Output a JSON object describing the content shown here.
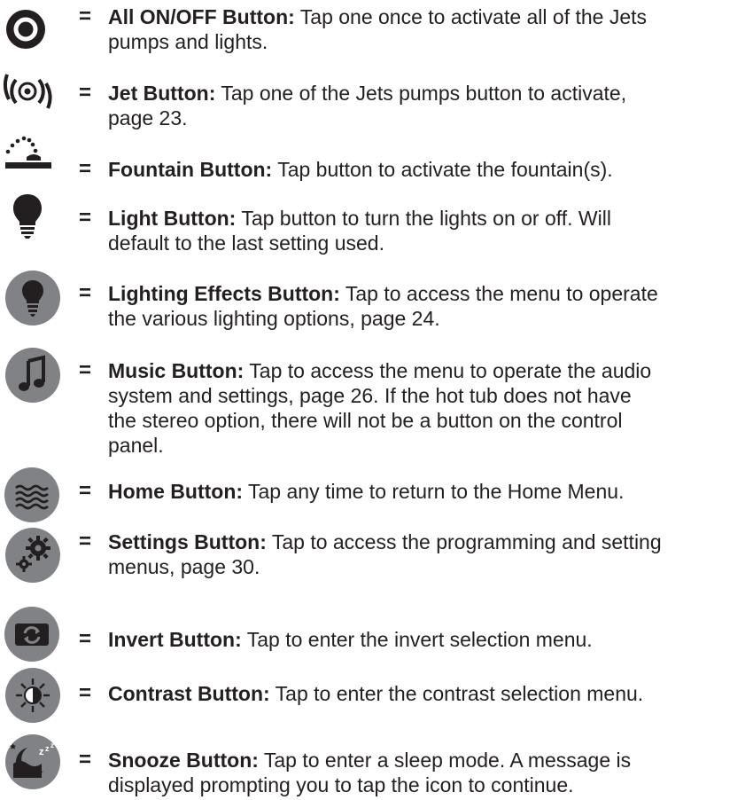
{
  "colors": {
    "icon_dark": "#231f20",
    "icon_circle": "#808285",
    "icon_white": "#ffffff",
    "text": "#231f20"
  },
  "items": [
    {
      "icon": "all-on-off-icon",
      "term": "All ON/OFF Button:",
      "desc": "Tap one once to activate all of the Jets pumps and lights.",
      "lines": [
        "Tap one once to activate all of the Jets",
        "pumps and lights."
      ]
    },
    {
      "icon": "jet-icon",
      "term": "Jet Button:",
      "desc": "Tap one of the Jets pumps button to activate, page 23.",
      "lines": [
        "Tap one of the Jets pumps button to activate,",
        "page 23."
      ]
    },
    {
      "icon": "fountain-icon",
      "term": "Fountain Button:",
      "desc": "Tap button to activate the fountain(s).",
      "lines": [
        "Tap button to activate the fountain(s)."
      ]
    },
    {
      "icon": "light-bulb-icon",
      "term": "Light Button:",
      "desc": "Tap button to turn the lights on or off. Will default to the last setting used.",
      "lines": [
        "Tap button to turn the lights on or off. Will",
        "default to the last setting used."
      ]
    },
    {
      "icon": "lighting-effects-icon",
      "term": "Lighting Effects Button:",
      "desc": "Tap to access the menu to operate the various lighting options, page 24.",
      "lines": [
        "Tap to access the menu to operate",
        "the various lighting options, page 24."
      ]
    },
    {
      "icon": "music-note-icon",
      "term": "Music Button:",
      "desc": "Tap to access the menu to operate the audio system and settings, page 26. If the hot tub does not have the stereo option, there will not be a button on the control panel.",
      "lines": [
        "Tap to access the menu to operate the audio",
        "system and settings, page 26. If the hot tub does not have",
        "the stereo option, there will not be a button on the control",
        "panel."
      ]
    },
    {
      "icon": "home-waves-icon",
      "term": "Home Button:",
      "desc": "Tap any time to return to the Home Menu.",
      "lines": [
        "Tap any time to return to the Home Menu."
      ]
    },
    {
      "icon": "settings-gears-icon",
      "term": "Settings Button:",
      "desc": "Tap to access the programming and setting menus, page 30.",
      "lines": [
        "Tap to access the programming and setting",
        "menus, page 30."
      ]
    },
    {
      "icon": "invert-icon",
      "term": "Invert Button:",
      "desc": "Tap to enter the invert selection menu.",
      "lines": [
        "Tap to enter the invert selection menu."
      ]
    },
    {
      "icon": "contrast-icon",
      "term": "Contrast Button:",
      "desc": "Tap to enter the contrast selection menu.",
      "lines": [
        "Tap to enter the contrast selection menu."
      ]
    },
    {
      "icon": "snooze-icon",
      "term": "Snooze Button:",
      "desc": "Tap to enter a sleep mode. A message is displayed prompting you to tap the icon to continue.",
      "lines": [
        "Tap to enter a sleep mode. A message is",
        "displayed prompting you to tap the icon to continue."
      ]
    }
  ],
  "equals": "="
}
